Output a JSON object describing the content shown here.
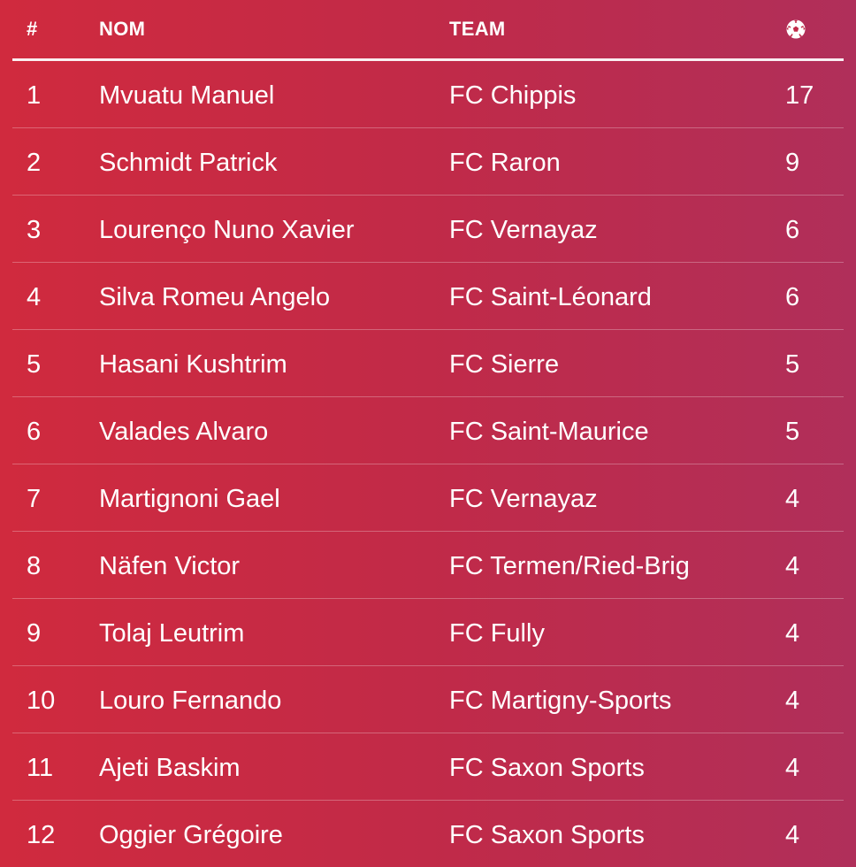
{
  "header": {
    "rank": "#",
    "name": "NOM",
    "team": "TEAM",
    "goals_icon": "soccer-ball-icon"
  },
  "rows": [
    {
      "rank": "1",
      "name": "Mvuatu Manuel",
      "team": "FC Chippis",
      "goals": "17"
    },
    {
      "rank": "2",
      "name": "Schmidt Patrick",
      "team": "FC Raron",
      "goals": "9"
    },
    {
      "rank": "3",
      "name": "Lourenço Nuno Xavier",
      "team": "FC Vernayaz",
      "goals": "6"
    },
    {
      "rank": "4",
      "name": "Silva Romeu Angelo",
      "team": "FC Saint-Léonard",
      "goals": "6"
    },
    {
      "rank": "5",
      "name": "Hasani Kushtrim",
      "team": "FC Sierre",
      "goals": "5"
    },
    {
      "rank": "6",
      "name": "Valades Alvaro",
      "team": "FC Saint-Maurice",
      "goals": "5"
    },
    {
      "rank": "7",
      "name": "Martignoni Gael",
      "team": "FC Vernayaz",
      "goals": "4"
    },
    {
      "rank": "8",
      "name": "Näfen Victor",
      "team": "FC Termen/Ried-Brig",
      "goals": "4"
    },
    {
      "rank": "9",
      "name": "Tolaj Leutrim",
      "team": "FC Fully",
      "goals": "4"
    },
    {
      "rank": "10",
      "name": "Louro Fernando",
      "team": "FC Martigny-Sports",
      "goals": "4"
    },
    {
      "rank": "11",
      "name": "Ajeti Baskim",
      "team": "FC Saxon Sports",
      "goals": "4"
    },
    {
      "rank": "12",
      "name": "Oggier Grégoire",
      "team": "FC Saxon Sports",
      "goals": "4"
    }
  ],
  "colors": {
    "background_start": "#d02a3e",
    "background_end": "#b02f5a",
    "text": "#ffffff"
  }
}
